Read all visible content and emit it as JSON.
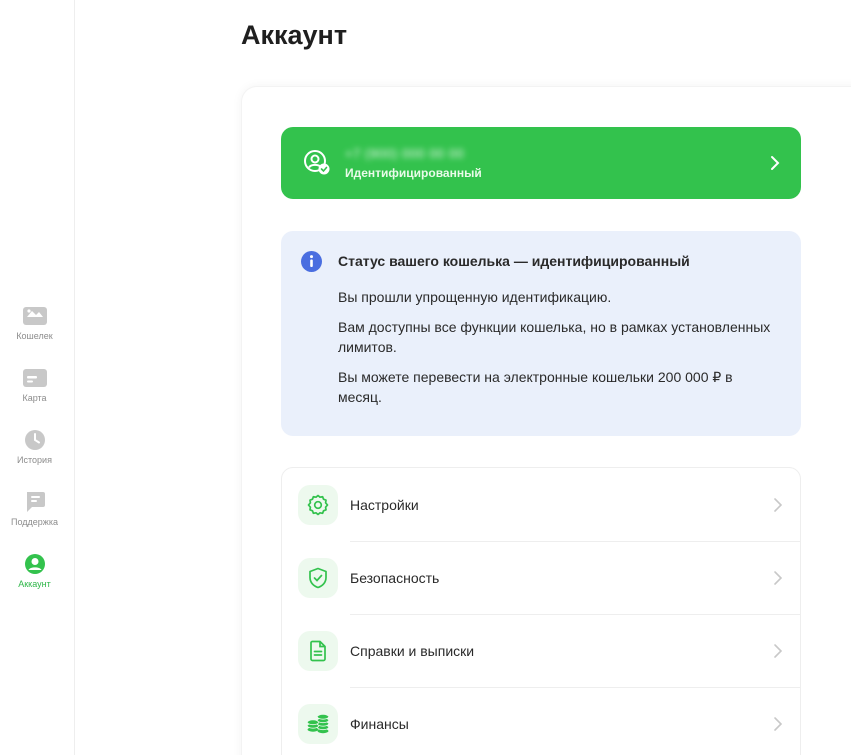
{
  "page": {
    "title": "Аккаунт"
  },
  "sidebar": {
    "items": [
      {
        "label": "Кошелек",
        "icon": "wallet-icon",
        "active": false
      },
      {
        "label": "Карта",
        "icon": "card-icon",
        "active": false
      },
      {
        "label": "История",
        "icon": "clock-icon",
        "active": false
      },
      {
        "label": "Поддержка",
        "icon": "chat-icon",
        "active": false
      },
      {
        "label": "Аккаунт",
        "icon": "user-icon",
        "active": true
      }
    ]
  },
  "account": {
    "phone": "+7 (900) 000 00 00",
    "status": "Идентифицированный"
  },
  "info": {
    "title": "Статус вашего кошелька — идентифицированный",
    "lines": [
      "Вы прошли упрощенную идентификацию.",
      "Вам доступны все функции кошелька, но в рамках установленных лимитов.",
      "Вы можете перевести на электронные кошельки 200 000 ₽ в месяц."
    ]
  },
  "menu": {
    "items": [
      {
        "label": "Настройки",
        "icon": "gear-icon"
      },
      {
        "label": "Безопасность",
        "icon": "shield-check-icon"
      },
      {
        "label": "Справки и выписки",
        "icon": "document-icon"
      },
      {
        "label": "Финансы",
        "icon": "coins-icon"
      }
    ]
  },
  "colors": {
    "accent": "#33c24d",
    "info_bg": "#eaf0fb",
    "info_icon": "#4a6ee0",
    "icon_grey": "#c8c8c8"
  }
}
